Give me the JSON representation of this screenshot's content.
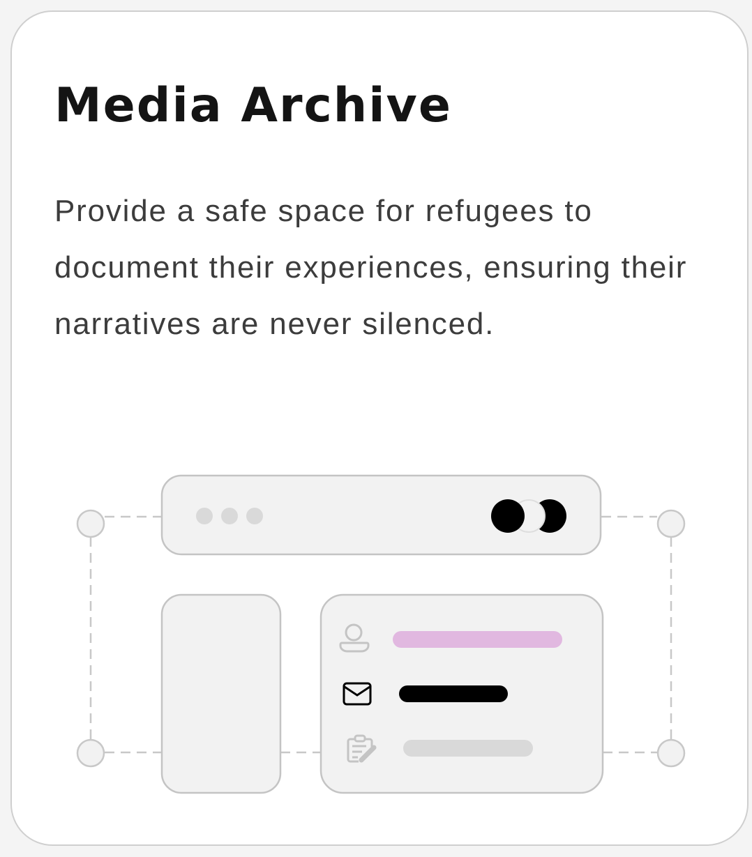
{
  "card": {
    "title": "Media Archive",
    "description": "Provide a safe space for refugees to document their experiences, ensuring their narratives are never silenced."
  },
  "illustration": {
    "icons": [
      "user-icon",
      "mail-icon",
      "clipboard-edit-icon"
    ],
    "colors": {
      "panel": "#f2f2f2",
      "border": "#c4c4c4",
      "accent_bar": "#e1b8e0",
      "dark_bar": "#000000",
      "light_bar": "#d9d9d9"
    }
  }
}
